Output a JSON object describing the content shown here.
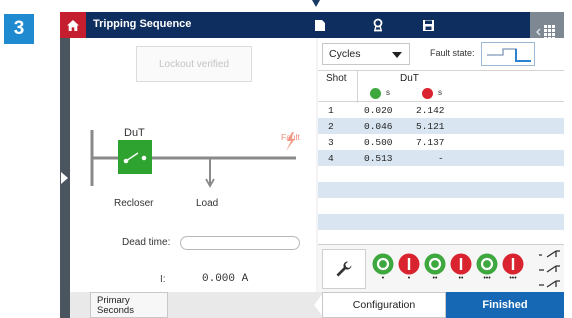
{
  "step_number": "3",
  "header": {
    "title": "Tripping Sequence",
    "icons": [
      "document-icon",
      "badge-icon",
      "save-icon",
      "grid-menu-icon"
    ]
  },
  "left_panel": {
    "lockout_button": "Lockout verified",
    "diagram": {
      "dut_label": "DuT",
      "fault_label": "Fault",
      "recloser_label": "Recloser",
      "load_label": "Load"
    },
    "dead_time_label": "Dead time:",
    "dead_time_value": "",
    "current_label": "I:",
    "current_value": "0.000 A"
  },
  "right_panel": {
    "cycles_select": "Cycles",
    "fault_state_label": "Fault state:",
    "table": {
      "col_shot": "Shot",
      "col_dut": "DuT",
      "unit_closed": "s",
      "unit_open": "s",
      "rows": [
        {
          "shot": "1",
          "closed": "0.020",
          "open": "2.142"
        },
        {
          "shot": "2",
          "closed": "0.046",
          "open": "5.121"
        },
        {
          "shot": "3",
          "closed": "0.500",
          "open": "7.137"
        },
        {
          "shot": "4",
          "closed": "0.513",
          "open": "-"
        }
      ]
    },
    "state_sequence": [
      {
        "state": "closed",
        "dots": "•"
      },
      {
        "state": "open",
        "dots": "•"
      },
      {
        "state": "closed",
        "dots": "••"
      },
      {
        "state": "open",
        "dots": "••"
      },
      {
        "state": "closed",
        "dots": "•••"
      },
      {
        "state": "open",
        "dots": "•••"
      }
    ]
  },
  "footer": {
    "primary_button_line1": "Primary",
    "primary_button_line2": "Seconds",
    "configuration_button": "Configuration",
    "finished_button": "Finished"
  },
  "colors": {
    "header_bg": "#0d2e5e",
    "home_red": "#c51e2e",
    "accent_blue": "#1667b4",
    "step_badge": "#1f8ad0",
    "closed_green": "#3ea83e",
    "open_red": "#d9232e",
    "row_highlight": "#d9e6f2",
    "breaker_green": "#2fa330",
    "fault_orange": "#f08a7a"
  }
}
